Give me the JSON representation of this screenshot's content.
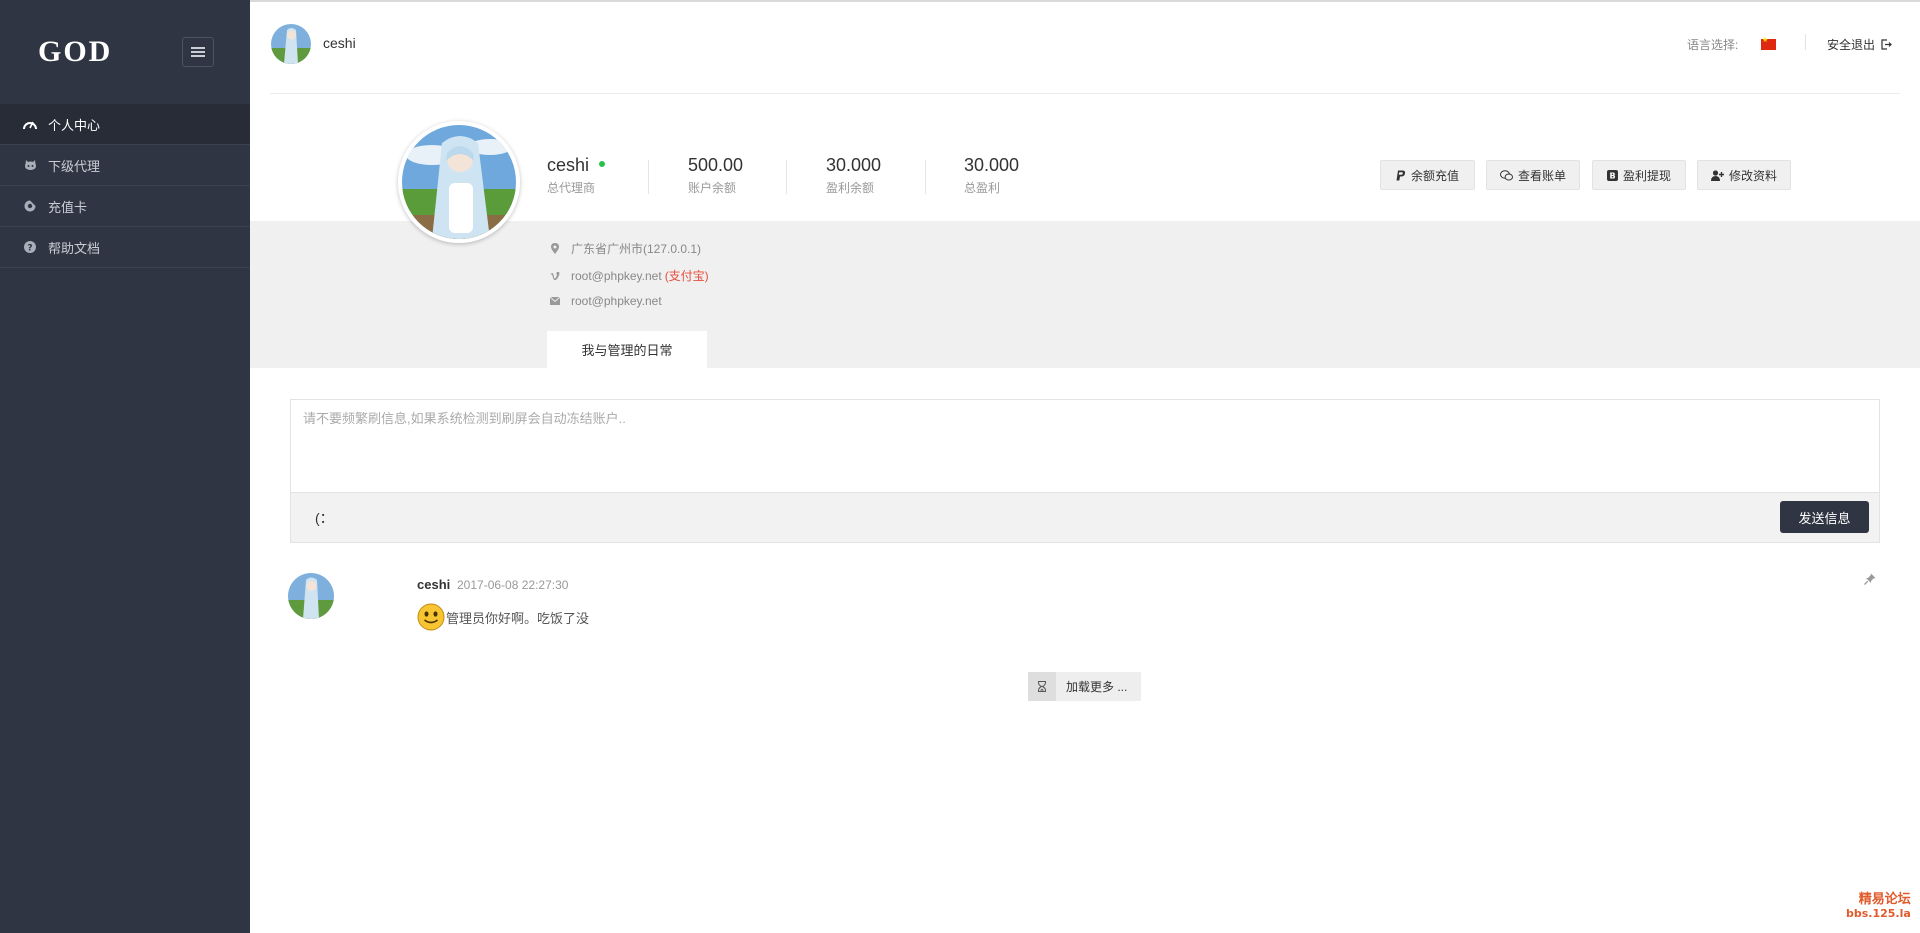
{
  "brand": {
    "logo_text": "GOD"
  },
  "sidebar": {
    "items": [
      {
        "label": "个人中心",
        "icon": "dashboard-icon",
        "active": true
      },
      {
        "label": "下级代理",
        "icon": "github-icon",
        "active": false
      },
      {
        "label": "充值卡",
        "icon": "card-icon",
        "active": false
      },
      {
        "label": "帮助文档",
        "icon": "help-icon",
        "active": false
      }
    ]
  },
  "header": {
    "username": "ceshi",
    "language_label": "语言选择:",
    "language_flag": "china-flag-icon",
    "logout_label": "安全退出"
  },
  "profile": {
    "name": "ceshi",
    "role": "总代理商",
    "online": true,
    "stats": [
      {
        "value": "500.00",
        "label": "账户余额"
      },
      {
        "value": "30.000",
        "label": "盈利余额"
      },
      {
        "value": "30.000",
        "label": "总盈利"
      }
    ],
    "actions": [
      {
        "label": "余额充值",
        "icon": "paypal-icon"
      },
      {
        "label": "查看账单",
        "icon": "wechat-icon"
      },
      {
        "label": "盈利提现",
        "icon": "bitcoin-icon"
      },
      {
        "label": "修改资料",
        "icon": "user-plus-icon"
      }
    ],
    "location": "广东省广州市(127.0.0.1)",
    "payment_account": "root@phpkey.net",
    "payment_method": "(支付宝)",
    "email": "root@phpkey.net"
  },
  "tabs": {
    "active": "我与管理的日常"
  },
  "composer": {
    "placeholder": "请不要频繁刷信息,如果系统检测到刷屏会自动冻结账户..",
    "emoji_label": "(：",
    "send_label": "发送信息"
  },
  "posts": [
    {
      "author": "ceshi",
      "time": "2017-06-08 22:27:30",
      "content": "管理员你好啊。吃饭了没"
    }
  ],
  "load_more_label": "加载更多 ...",
  "watermark": {
    "line1": "精易论坛",
    "line2": "bbs.125.la"
  },
  "colors": {
    "sidebar_bg": "#2f3542",
    "accent_dark": "#2f3542",
    "online": "#27c24c",
    "alert_red": "#e74c3c"
  }
}
